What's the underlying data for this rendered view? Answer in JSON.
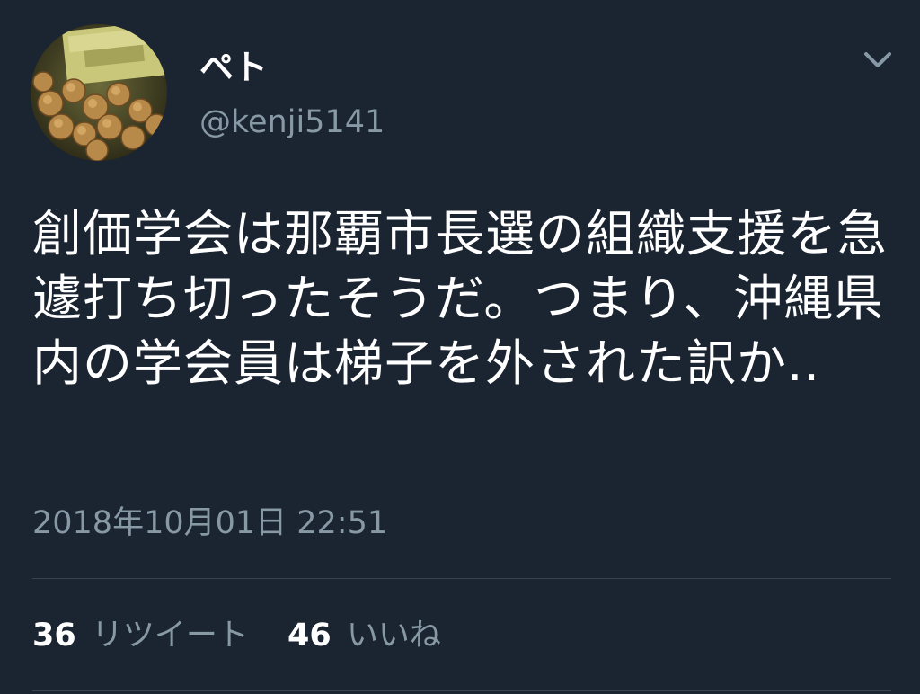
{
  "user": {
    "display_name": "ペト",
    "handle": "@kenji5141",
    "avatar_icon": "avatar-photo"
  },
  "tweet": {
    "text": "創価学会は那覇市長選の組織支援を急遽打ち切ったそうだ。つまり、沖縄県内の学会員は梯子を外された訳か..",
    "timestamp": "2018年10月01日 22:51"
  },
  "stats": {
    "retweets_count": "36",
    "retweets_label": "リツイート",
    "likes_count": "46",
    "likes_label": "いいね"
  },
  "menu": {
    "icon": "chevron-down-icon"
  },
  "colors": {
    "background": "#1b2431",
    "text": "#ffffff",
    "secondary_text": "#8899a6",
    "divider": "#38444d"
  }
}
